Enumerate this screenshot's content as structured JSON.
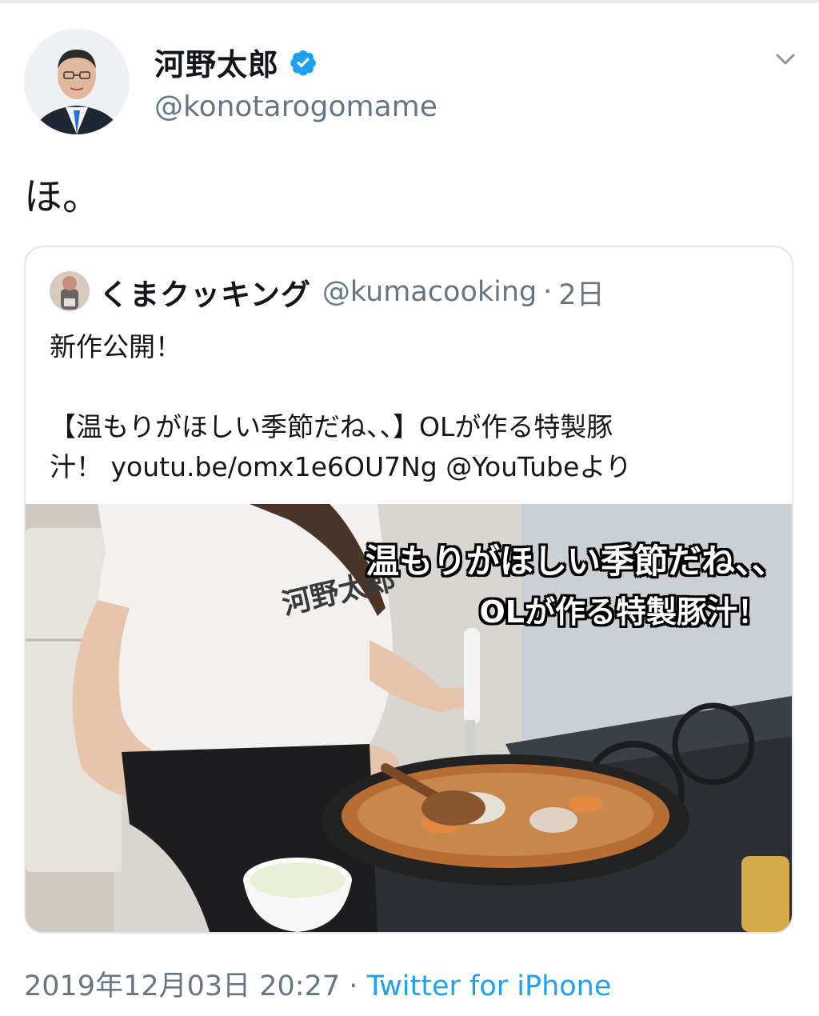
{
  "tweet": {
    "author_name": "河野太郎",
    "author_handle": "@konotarogomame",
    "text": "ほ。",
    "timestamp": "2019年12月03日 20:27",
    "separator": "·",
    "source": "Twitter for iPhone"
  },
  "quoted_tweet": {
    "author_name": "くまクッキング",
    "author_handle": "@kumacooking",
    "separator": "·",
    "time_ago": "2日",
    "text_line1": "新作公開！",
    "text_line2": "【温もりがほしい季節だね、、】OLが作る特製豚",
    "text_line3": "汁！ youtu.be/omx1e6OU7Ng @YouTubeより",
    "media": {
      "caption_line1": "温もりがほしい季節だね、、",
      "caption_line2": "OLが作る特製豚汁！",
      "shirt_text": "河野太郎"
    }
  },
  "colors": {
    "text_primary": "#14171a",
    "text_secondary": "#657786",
    "link": "#1da1f2",
    "border": "#e1e8ed",
    "verified": "#1da1f2"
  },
  "icons": [
    "verified-badge-icon",
    "chevron-down-icon"
  ]
}
